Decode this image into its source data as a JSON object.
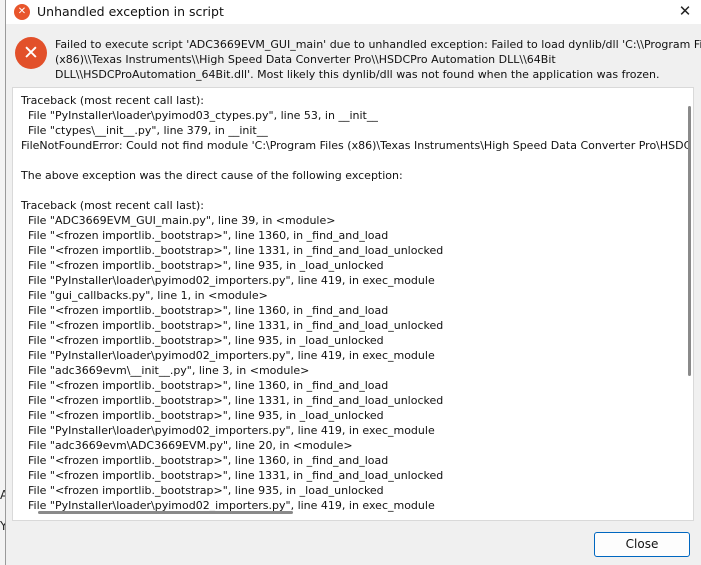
{
  "background": {
    "letters": [
      "A",
      "Y"
    ]
  },
  "dialog": {
    "title": "Unhandled exception in script",
    "title_close_glyph": "✕",
    "message_lines": [
      "Failed to execute script 'ADC3669EVM_GUI_main' due to unhandled exception: Failed to load dynlib/dll 'C:\\\\Program Files",
      "(x86)\\\\Texas Instruments\\\\High Speed Data Converter Pro\\\\HSDCPro Automation DLL\\\\64Bit",
      "DLL\\\\HSDCProAutomation_64Bit.dll'. Most likely this dynlib/dll was not found when the application was frozen."
    ],
    "traceback_lines": [
      "Traceback (most recent call last):",
      "  File \"PyInstaller\\loader\\pyimod03_ctypes.py\", line 53, in __init__",
      "  File \"ctypes\\__init__.py\", line 379, in __init__",
      "FileNotFoundError: Could not find module 'C:\\Program Files (x86)\\Texas Instruments\\High Speed Data Converter Pro\\HSDC",
      "",
      "The above exception was the direct cause of the following exception:",
      "",
      "Traceback (most recent call last):",
      "  File \"ADC3669EVM_GUI_main.py\", line 39, in <module>",
      "  File \"<frozen importlib._bootstrap>\", line 1360, in _find_and_load",
      "  File \"<frozen importlib._bootstrap>\", line 1331, in _find_and_load_unlocked",
      "  File \"<frozen importlib._bootstrap>\", line 935, in _load_unlocked",
      "  File \"PyInstaller\\loader\\pyimod02_importers.py\", line 419, in exec_module",
      "  File \"gui_callbacks.py\", line 1, in <module>",
      "  File \"<frozen importlib._bootstrap>\", line 1360, in _find_and_load",
      "  File \"<frozen importlib._bootstrap>\", line 1331, in _find_and_load_unlocked",
      "  File \"<frozen importlib._bootstrap>\", line 935, in _load_unlocked",
      "  File \"PyInstaller\\loader\\pyimod02_importers.py\", line 419, in exec_module",
      "  File \"adc3669evm\\__init__.py\", line 3, in <module>",
      "  File \"<frozen importlib._bootstrap>\", line 1360, in _find_and_load",
      "  File \"<frozen importlib._bootstrap>\", line 1331, in _find_and_load_unlocked",
      "  File \"<frozen importlib._bootstrap>\", line 935, in _load_unlocked",
      "  File \"PyInstaller\\loader\\pyimod02_importers.py\", line 419, in exec_module",
      "  File \"adc3669evm\\ADC3669EVM.py\", line 20, in <module>",
      "  File \"<frozen importlib._bootstrap>\", line 1360, in _find_and_load",
      "  File \"<frozen importlib._bootstrap>\", line 1331, in _find_and_load_unlocked",
      "  File \"<frozen importlib._bootstrap>\", line 935, in _load_unlocked",
      "  File \"PyInstaller\\loader\\pyimod02_importers.py\", line 419, in exec_module"
    ],
    "close_label": "Close",
    "colors": {
      "error_red": "#e2502a",
      "button_border": "#0067c0",
      "dialog_bg": "#f0f0f0"
    },
    "icons": [
      "error-icon",
      "close-icon"
    ]
  }
}
